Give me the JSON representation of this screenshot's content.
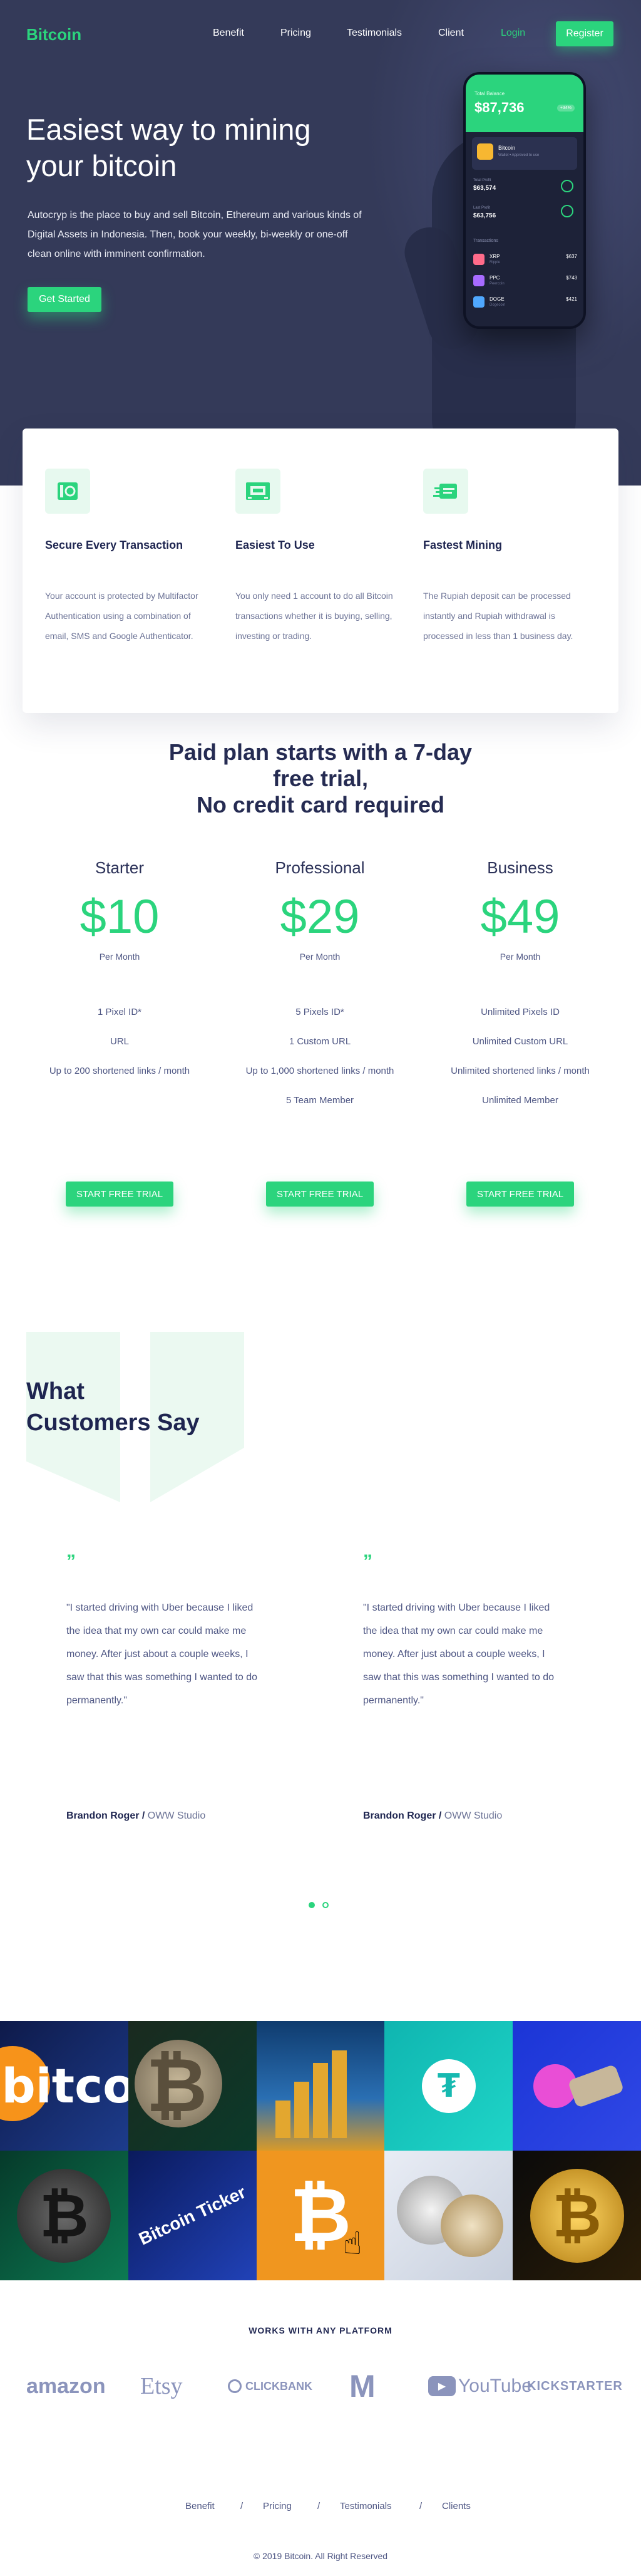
{
  "header": {
    "logo": "Bitcoin",
    "nav": [
      "Benefit",
      "Pricing",
      "Testimonials",
      "Client"
    ],
    "login": "Login",
    "register": "Register"
  },
  "hero": {
    "title_line1": "Easiest way to mining",
    "title_line2": "your bitcoin",
    "description": "Autocryp is the place to buy and sell Bitcoin, Ethereum and various kinds of Digital Assets in Indonesia. Then, book your weekly, bi-weekly or one-off clean online with imminent confirmation.",
    "cta": "Get Started",
    "phone": {
      "balance_label": "Total Balance",
      "balance": "$87,736",
      "change": "+34%",
      "card_title": "Bitcoin",
      "card_sub": "Wallet • Approved to use",
      "stat1_label": "Total Profit",
      "stat1_value": "$63,574",
      "stat2_label": "Last Profit",
      "stat2_value": "$63,756",
      "section": "Transactions",
      "rows": [
        {
          "name": "XRP",
          "sub": "Ripple",
          "value": "$637",
          "color": "#ff6b8a"
        },
        {
          "name": "PPC",
          "sub": "Peercoin",
          "value": "$743",
          "color": "#a76bff"
        },
        {
          "name": "DOGE",
          "sub": "Dogecoin",
          "value": "$421",
          "color": "#4fa8ff"
        }
      ]
    }
  },
  "features": [
    {
      "icon": "bitcoin-card-icon",
      "title": "Secure Every Transaction",
      "desc": "Your account is protected by Multifactor Authentication using a combination of email, SMS and Google Authenticator."
    },
    {
      "icon": "wallet-icon",
      "title": "Easiest To Use",
      "desc": "You only need 1 account to do all Bitcoin transactions whether it is buying, selling, investing or trading."
    },
    {
      "icon": "fast-card-icon",
      "title": "Fastest Mining",
      "desc": "The Rupiah deposit can be processed instantly and Rupiah withdrawal is processed in less than 1 business day."
    }
  ],
  "pricing": {
    "heading_line1": "Paid plan starts with a 7-day",
    "heading_line2": "free trial,",
    "heading_line3": "No credit card required",
    "plans": [
      {
        "name": "Starter",
        "price": "$10",
        "per": "Per Month",
        "features": [
          "1 Pixel ID*",
          "URL",
          "Up to 200 shortened links / month"
        ],
        "cta": "START FREE TRIAL"
      },
      {
        "name": "Professional",
        "price": "$29",
        "per": "Per Month",
        "features": [
          "5 Pixels ID*",
          "1 Custom URL",
          "Up to 1,000 shortened links / month",
          "5 Team Member"
        ],
        "cta": "START FREE TRIAL"
      },
      {
        "name": "Business",
        "price": "$49",
        "per": "Per Month",
        "features": [
          "Unlimited Pixels ID",
          "Unlimited Custom URL",
          "Unlimited shortened links / month",
          "Unlimited Member"
        ],
        "cta": "START FREE TRIAL"
      }
    ]
  },
  "testimonials": {
    "heading_line1": "What",
    "heading_line2": "Customers Say",
    "quote_mark": "”",
    "items": [
      {
        "text": "\"I started driving with Uber because I liked the idea that my own car could make me money. After just about a couple weeks, I saw that this was something I wanted to do permanently.\"",
        "author": "Brandon Roger",
        "sep": " / ",
        "company": "OWW Studio"
      },
      {
        "text": "\"I started driving with Uber because I liked the idea that my own car could make me money. After just about a couple weeks, I saw that this was something I wanted to do permanently.\"",
        "author": "Brandon Roger",
        "sep": " / ",
        "company": "OWW Studio"
      }
    ],
    "active_dot": 0
  },
  "gallery": {
    "tile_text_1": "bitcoi",
    "tile_text_8": "Bitcoin Ticker"
  },
  "platforms": {
    "heading": "WORKS WITH ANY PLATFORM",
    "brands": [
      "amazon",
      "Etsy",
      "CLICKBANK",
      "M",
      "YouTube",
      "KICKSTARTER"
    ]
  },
  "footer": {
    "links": [
      "Benefit",
      "Pricing",
      "Testimonials",
      "Clients"
    ],
    "separator": "/",
    "copyright": "© 2019 Bitcoin. All Right Reserved"
  },
  "colors": {
    "accent": "#2bd47d",
    "hero_bg": "#343a59",
    "navy_text": "#1e2550"
  }
}
